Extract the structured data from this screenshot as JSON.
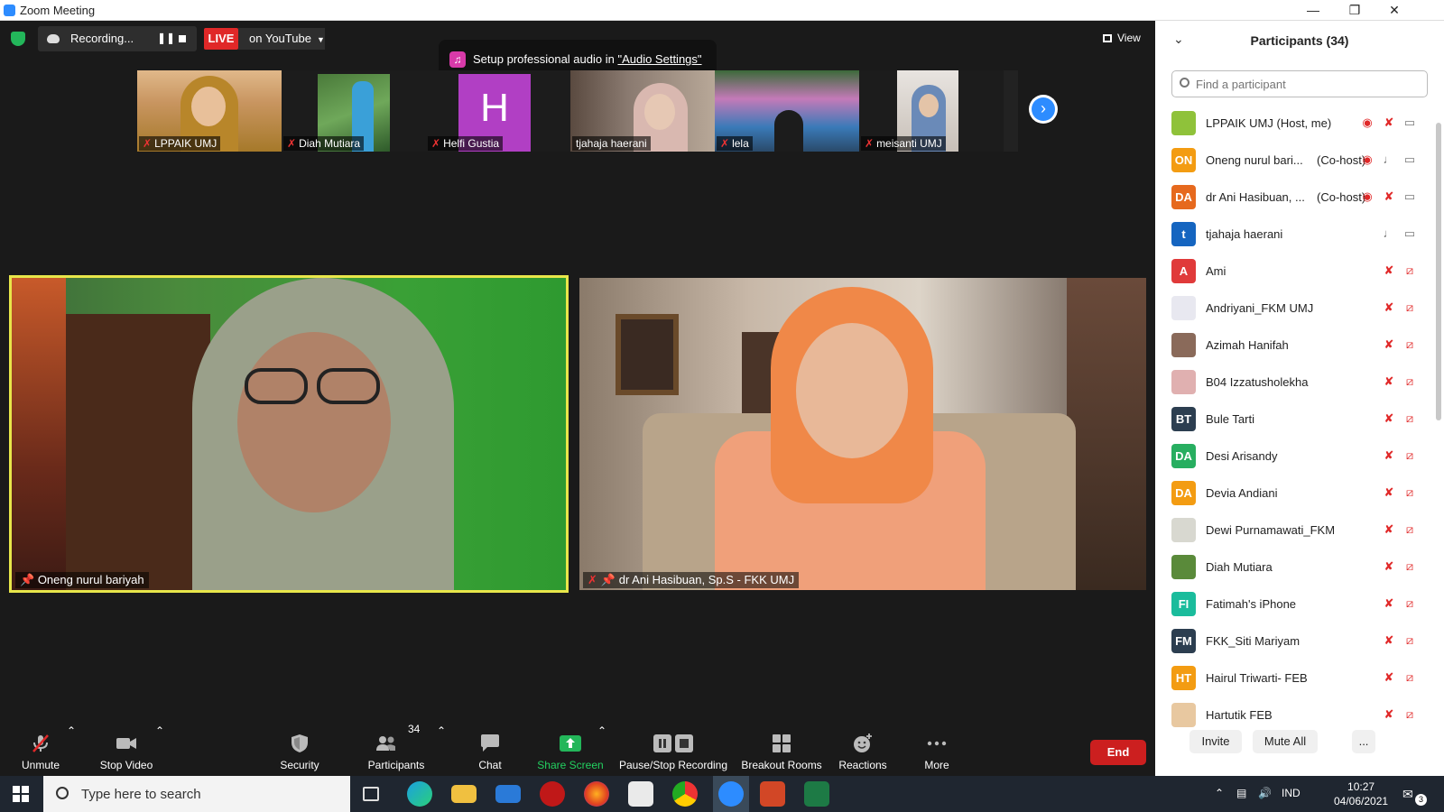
{
  "window": {
    "title": "Zoom Meeting",
    "min_icon": "minimize-icon",
    "max_icon": "restore-icon",
    "close_icon": "close-icon"
  },
  "recording": {
    "label": "Recording..."
  },
  "live": {
    "badge": "LIVE",
    "target": "on YouTube"
  },
  "toast": {
    "text": "Setup professional audio in ",
    "link": "\"Audio Settings\""
  },
  "view_label": "View",
  "thumbnails": [
    {
      "name": "LPPAIK UMJ",
      "muted": true
    },
    {
      "name": "Diah Mutiara",
      "muted": true
    },
    {
      "name": "Helfi Gustia",
      "muted": true,
      "initial": "H"
    },
    {
      "name": "tjahaja haerani",
      "muted": false
    },
    {
      "name": "lela",
      "muted": true
    },
    {
      "name": "meisanti UMJ",
      "muted": true
    }
  ],
  "videos": [
    {
      "name": "Oneng nurul bariyah",
      "pinned": true,
      "active": true
    },
    {
      "name": "dr Ani Hasibuan, Sp.S - FKK UMJ",
      "pinned": true,
      "muted": true
    }
  ],
  "toolbar": {
    "unmute": "Unmute",
    "stop_video": "Stop Video",
    "security": "Security",
    "participants": "Participants",
    "participants_count": "34",
    "chat": "Chat",
    "share_screen": "Share Screen",
    "pause_stop_recording": "Pause/Stop Recording",
    "breakout_rooms": "Breakout Rooms",
    "reactions": "Reactions",
    "more": "More",
    "end": "End"
  },
  "panel": {
    "title": "Participants (34)",
    "search_placeholder": "Find a participant",
    "invite": "Invite",
    "mute_all": "Mute All",
    "more": "..."
  },
  "participants": [
    {
      "initials": "",
      "name": "LPPAIK UMJ (Host, me)",
      "role": "",
      "color": "#8fc23a",
      "mic": "muted",
      "video": "on",
      "rec": true
    },
    {
      "initials": "ON",
      "name": "Oneng nurul bari...",
      "role": "(Co-host)",
      "color": "#f39c12",
      "mic": "on",
      "video": "on",
      "rec": true
    },
    {
      "initials": "DA",
      "name": "dr Ani Hasibuan, ...",
      "role": "(Co-host)",
      "color": "#e6691e",
      "mic": "muted",
      "video": "on",
      "rec": true
    },
    {
      "initials": "t",
      "name": "tjahaja haerani",
      "role": "",
      "color": "#1565c0",
      "mic": "on",
      "video": "on",
      "rec": false
    },
    {
      "initials": "A",
      "name": "Ami",
      "role": "",
      "color": "#e03a3a",
      "mic": "muted",
      "video": "off",
      "rec": false
    },
    {
      "initials": "",
      "name": "Andriyani_FKM UMJ",
      "role": "",
      "color": "#e8e8f0",
      "mic": "muted",
      "video": "off",
      "rec": false
    },
    {
      "initials": "",
      "name": "Azimah Hanifah",
      "role": "",
      "color": "#8a6a5a",
      "mic": "muted",
      "video": "off",
      "rec": false
    },
    {
      "initials": "",
      "name": "B04 Izzatusholekha",
      "role": "",
      "color": "#e0b0b0",
      "mic": "muted",
      "video": "off",
      "rec": false
    },
    {
      "initials": "BT",
      "name": "Bule Tarti",
      "role": "",
      "color": "#2c3e50",
      "mic": "muted",
      "video": "off",
      "rec": false
    },
    {
      "initials": "DA",
      "name": "Desi Arisandy",
      "role": "",
      "color": "#27ae60",
      "mic": "muted",
      "video": "off",
      "rec": false
    },
    {
      "initials": "DA",
      "name": "Devia Andiani",
      "role": "",
      "color": "#f39c12",
      "mic": "muted",
      "video": "off",
      "rec": false
    },
    {
      "initials": "",
      "name": "Dewi Purnamawati_FKM",
      "role": "",
      "color": "#d8d8d0",
      "mic": "muted",
      "video": "off",
      "rec": false
    },
    {
      "initials": "",
      "name": "Diah Mutiara",
      "role": "",
      "color": "#5a8a3a",
      "mic": "muted",
      "video": "off",
      "rec": false
    },
    {
      "initials": "FI",
      "name": "Fatimah's iPhone",
      "role": "",
      "color": "#1abc9c",
      "mic": "muted",
      "video": "off",
      "rec": false
    },
    {
      "initials": "FM",
      "name": "FKK_Siti Mariyam",
      "role": "",
      "color": "#2c3e50",
      "mic": "muted",
      "video": "off",
      "rec": false
    },
    {
      "initials": "HT",
      "name": "Hairul Triwarti- FEB",
      "role": "",
      "color": "#f39c12",
      "mic": "muted",
      "video": "off",
      "rec": false
    },
    {
      "initials": "",
      "name": "Hartutik FEB",
      "role": "",
      "color": "#e8c8a0",
      "mic": "muted",
      "video": "off",
      "rec": false
    }
  ],
  "taskbar": {
    "search_placeholder": "Type here to search",
    "lang": "IND",
    "time": "10:27",
    "date": "04/06/2021",
    "notifications": "3"
  }
}
